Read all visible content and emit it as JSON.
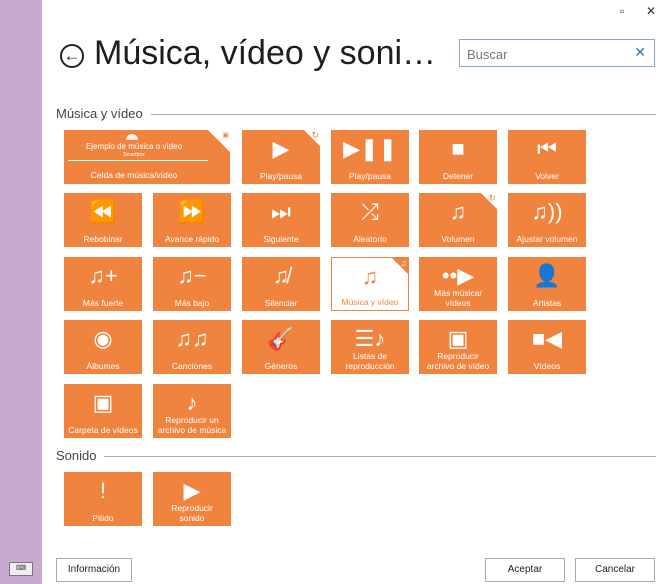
{
  "window": {
    "minimize_icon": "▫",
    "close_icon": "✕"
  },
  "header": {
    "title": "Música, vídeo y soni…",
    "search_placeholder": "Buscar",
    "search_clear_icon": "✕"
  },
  "sections": {
    "music_video": "Música y vídeo",
    "sound": "Sonido"
  },
  "cell_demo": {
    "line1": "Ejemplo de música o vídeo",
    "line2": "Smartbox",
    "label": "Celda de música/vídeo"
  },
  "tiles": [
    {
      "label": "Play/pausa",
      "icon": "▶",
      "corner": true,
      "cicon": "↻"
    },
    {
      "label": "Play/pausa",
      "icon": "▶❚❚",
      "corner": false,
      "cicon": ""
    },
    {
      "label": "Detener",
      "icon": "■",
      "corner": false,
      "cicon": ""
    },
    {
      "label": "Volver",
      "icon": "⏮",
      "corner": false,
      "cicon": ""
    },
    {
      "label": "Rebobinar",
      "icon": "⏪",
      "corner": false,
      "cicon": ""
    },
    {
      "label": "Avance rápido",
      "icon": "⏩",
      "corner": false,
      "cicon": ""
    },
    {
      "label": "Siguiente",
      "icon": "⏭",
      "corner": false,
      "cicon": ""
    },
    {
      "label": "Aleatorio",
      "icon": "⤮",
      "corner": false,
      "cicon": ""
    },
    {
      "label": "Volumen",
      "icon": "♫",
      "corner": true,
      "cicon": "↻"
    },
    {
      "label": "Ajustar volumen",
      "icon": "♫))",
      "corner": false,
      "cicon": ""
    },
    {
      "label": "Más fuerte",
      "icon": "♫+",
      "corner": false,
      "cicon": ""
    },
    {
      "label": "Más bajo",
      "icon": "♫−",
      "corner": false,
      "cicon": ""
    },
    {
      "label": "Silenciar",
      "icon": "♫̸",
      "corner": false,
      "cicon": ""
    },
    {
      "label": "Música y vídeo",
      "icon": "♫",
      "corner": true,
      "cicon": "♫",
      "selected": true
    },
    {
      "label": "Más música/\nvídeos",
      "icon": "••▶",
      "corner": false,
      "cicon": ""
    },
    {
      "label": "Artistas",
      "icon": "👤",
      "corner": false,
      "cicon": ""
    },
    {
      "label": "Álbumes",
      "icon": "◉",
      "corner": false,
      "cicon": ""
    },
    {
      "label": "Canciones",
      "icon": "♫♫",
      "corner": false,
      "cicon": ""
    },
    {
      "label": "Géneros",
      "icon": "🎸",
      "corner": false,
      "cicon": ""
    },
    {
      "label": "Listas de\nreproducción",
      "icon": "☰♪",
      "corner": false,
      "cicon": ""
    },
    {
      "label": "Reproducir\narchivo de vídeo",
      "icon": "▣",
      "corner": false,
      "cicon": ""
    },
    {
      "label": "Vídeos",
      "icon": "■◀",
      "corner": false,
      "cicon": ""
    },
    {
      "label": "Carpeta de vídeos",
      "icon": "▣",
      "corner": false,
      "cicon": ""
    },
    {
      "label": "Reproducir un\narchivo de música",
      "icon": "♪",
      "corner": false,
      "cicon": ""
    },
    {
      "label": "Pitido",
      "icon": "!",
      "corner": false,
      "cicon": ""
    },
    {
      "label": "Reproducir\nsonido",
      "icon": "▶",
      "corner": false,
      "cicon": ""
    }
  ],
  "buttons": {
    "info": "Información",
    "accept": "Aceptar",
    "cancel": "Cancelar"
  },
  "keyboard_icon": "⌨",
  "colors": {
    "tile": "#f0843e",
    "desktop": "#c8a9d0"
  }
}
